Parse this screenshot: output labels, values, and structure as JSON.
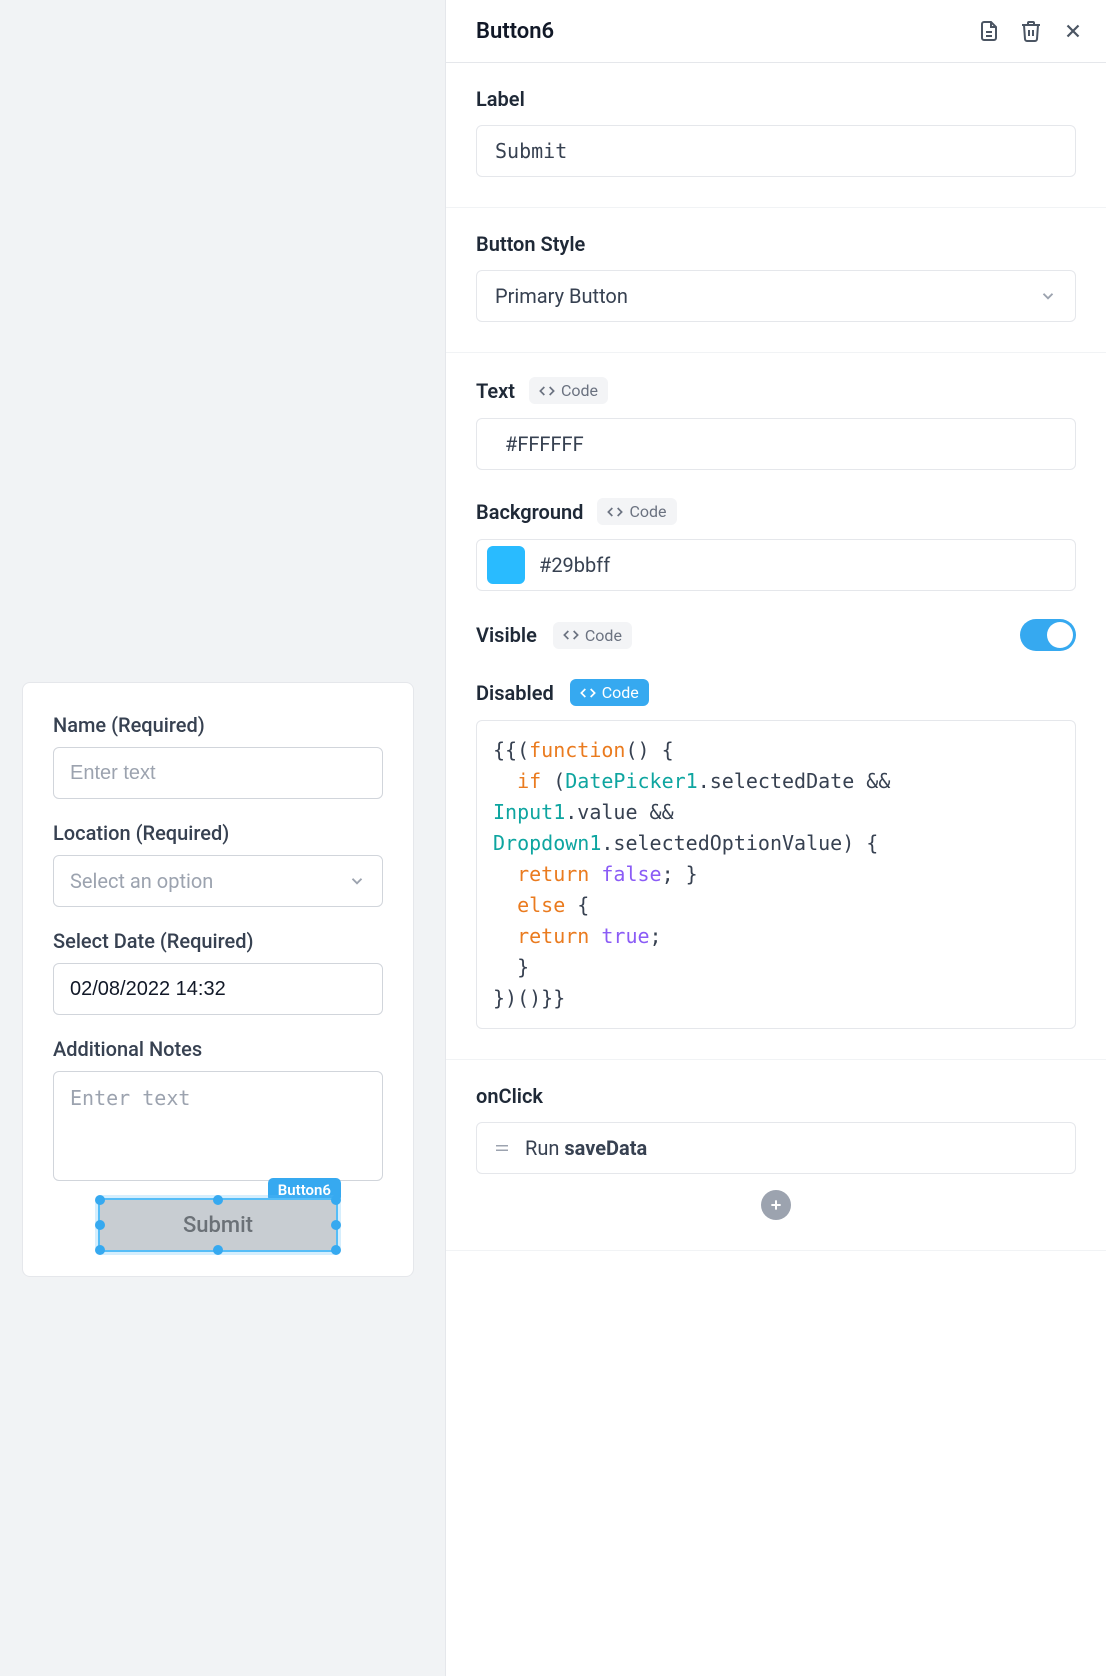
{
  "canvas": {
    "selected_badge": "Button6",
    "form": {
      "name_label": "Name (Required)",
      "name_placeholder": "Enter text",
      "location_label": "Location (Required)",
      "location_placeholder": "Select an option",
      "date_label": "Select Date (Required)",
      "date_value": "02/08/2022 14:32",
      "notes_label": "Additional Notes",
      "notes_placeholder": "Enter text",
      "submit_label": "Submit"
    }
  },
  "panel": {
    "title": "Button6",
    "label_section": "Label",
    "label_value": "Submit",
    "style_section": "Button Style",
    "style_value": "Primary Button",
    "text_section": "Text",
    "text_value": "#FFFFFF",
    "bg_section": "Background",
    "bg_value": "#29bbff",
    "visible_section": "Visible",
    "visible": true,
    "disabled_section": "Disabled",
    "code_chip": "Code",
    "disabled_code": {
      "l1a": "{{(",
      "l1b": "function",
      "l1c": "() {",
      "l2a": "  if",
      "l2b": " (",
      "l2c": "DatePicker1",
      "l2d": ".selectedDate && ",
      "l3a": "Input1",
      "l3b": ".value && ",
      "l4a": "Dropdown1",
      "l4b": ".selectedOptionValue) {",
      "l5a": "  return ",
      "l5b": "false",
      "l5c": "; }",
      "l6a": "  else",
      "l6b": " {",
      "l7a": "  return ",
      "l7b": "true",
      "l7c": ";",
      "l8": "  }",
      "l9": "})()}}"
    },
    "onclick_section": "onClick",
    "onclick_prefix": "Run ",
    "onclick_action": "saveData"
  }
}
